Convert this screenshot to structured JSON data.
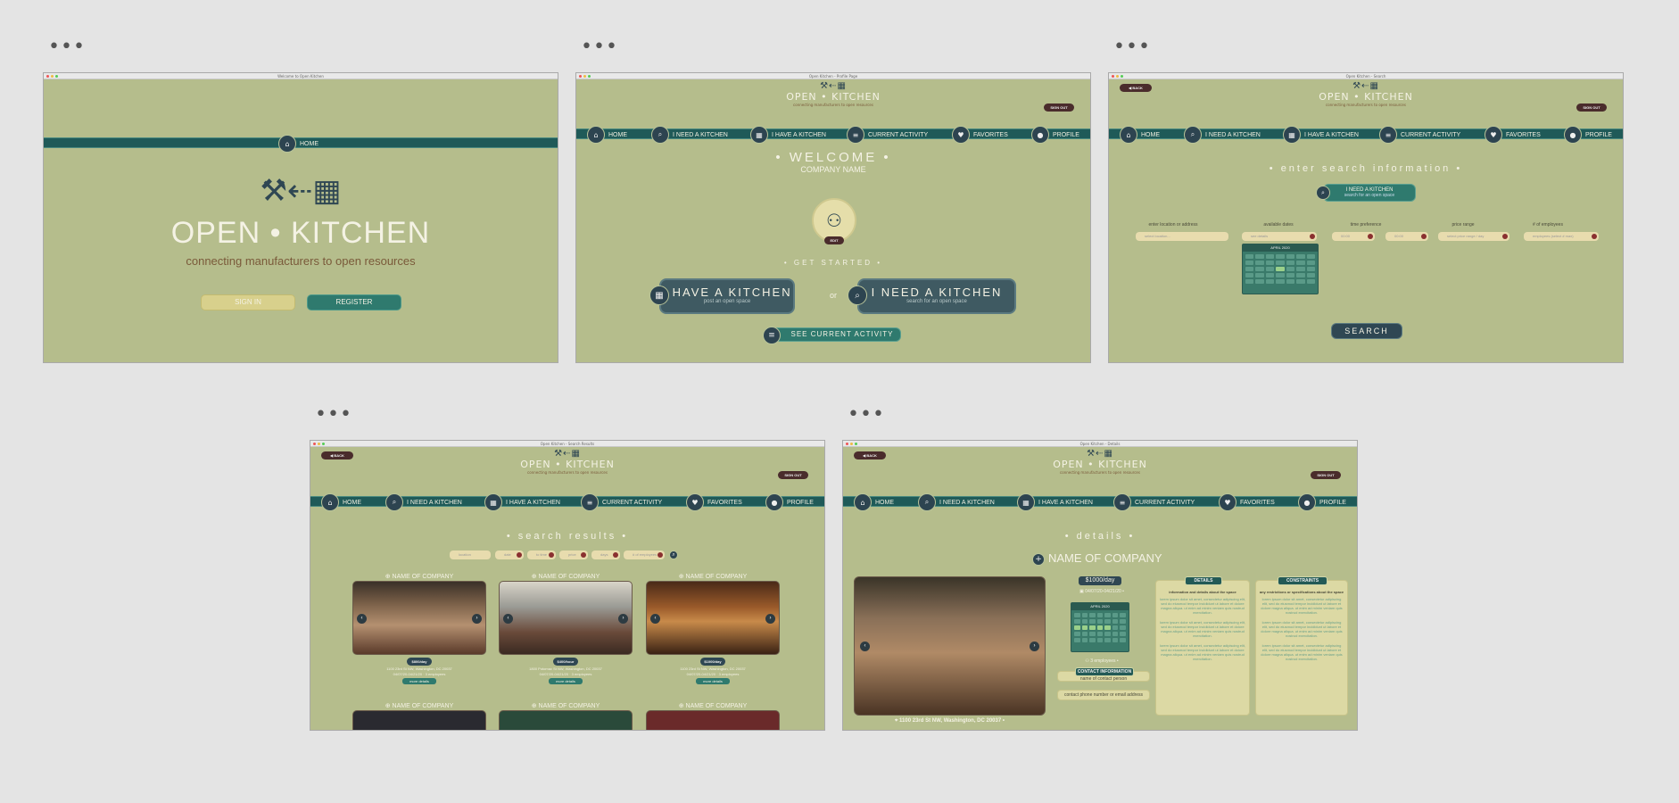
{
  "common": {
    "menu_dots": "•••",
    "back": "◀ BACK",
    "sign_out": "SIGN OUT",
    "app_name": "OPEN • KITCHEN",
    "tagline": "connecting manufacturers to open resources",
    "nav": {
      "home": "HOME",
      "need": "I NEED A KITCHEN",
      "have": "I HAVE A KITCHEN",
      "activity": "CURRENT ACTIVITY",
      "favorites": "FAVORITES",
      "profile": "PROFILE"
    }
  },
  "screen1": {
    "window_title": "Welcome to Open Kitchen",
    "title": "OPEN • KITCHEN",
    "tagline": "connecting manufacturers to open resources",
    "sign_in": "SIGN IN",
    "register": "REGISTER"
  },
  "screen2": {
    "window_title": "Open Kitchen - Profile Page",
    "welcome": "• WELCOME •",
    "company": "COMPANY NAME",
    "edit": "EDIT",
    "get_started": "• GET STARTED •",
    "have_title": "I HAVE A KITCHEN",
    "have_sub": "post an open space",
    "or": "or",
    "need_title": "I NEED A KITCHEN",
    "need_sub": "search for an open space",
    "activity": "SEE CURRENT ACTIVITY"
  },
  "screen3": {
    "window_title": "Open Kitchen - Search",
    "heading": "• enter search information •",
    "need_title": "I NEED A KITCHEN",
    "need_sub": "search for an open space",
    "labels": [
      "enter location or address",
      "available dates",
      "time preference",
      "price range",
      "# of employees"
    ],
    "placeholders": [
      "select location...",
      "see details",
      "00:00",
      "00:00",
      "select price range / day",
      "employees (select # max)"
    ],
    "calendar_month": "APRIL 2020",
    "search": "SEARCH"
  },
  "screen4": {
    "window_title": "Open Kitchen - Search Results",
    "heading": "• search results •",
    "filters": [
      "location",
      "date",
      "to time",
      "price",
      "days",
      "# of employees"
    ],
    "cards": [
      {
        "name": "NAME OF COMPANY",
        "price": "$800/day",
        "address": "1100 23rd St NW, Washington, DC 20037",
        "meta": "04/07/20-04/21/20 · 3 employees",
        "btn": "more details"
      },
      {
        "name": "NAME OF COMPANY",
        "price": "$400/hour",
        "address": "1800 Potomac St NW, Washington, DC 20037",
        "meta": "04/07/20-04/21/20 · 3 employees",
        "btn": "more details"
      },
      {
        "name": "NAME OF COMPANY",
        "price": "$1000/day",
        "address": "1100 23rd St NW, Washington, DC 20037",
        "meta": "04/07/20-04/21/20 · 3 employees",
        "btn": "more details"
      }
    ],
    "row2": [
      "NAME OF COMPANY",
      "NAME OF COMPANY",
      "NAME OF COMPANY"
    ]
  },
  "screen5": {
    "window_title": "Open Kitchen - Details",
    "heading": "• details •",
    "company": "NAME OF COMPANY",
    "price": "$1000/day",
    "dates": "04/07/20-04/21/20",
    "calendar_month": "APRIL 2020",
    "employees": "3 employees",
    "contact_tab": "CONTACT INFORMATION",
    "contact_name": "name of contact person",
    "contact_phone": "contact phone number or email address",
    "details_tab": "DETAILS",
    "details_head": "information and details about the space",
    "constraints_tab": "CONSTRAINTS",
    "constraints_head": "any restrictions or specifications about the space",
    "lorem": "lorem ipsum dolor sit amet, consectetur adipiscing elit, sed do eiusmod tempor incididunt ut labore et dolore magna aliqua. ut enim ad minim veniam quis nostrud exercitation.",
    "address": "1100 23rd St NW, Washington, DC 20037"
  }
}
